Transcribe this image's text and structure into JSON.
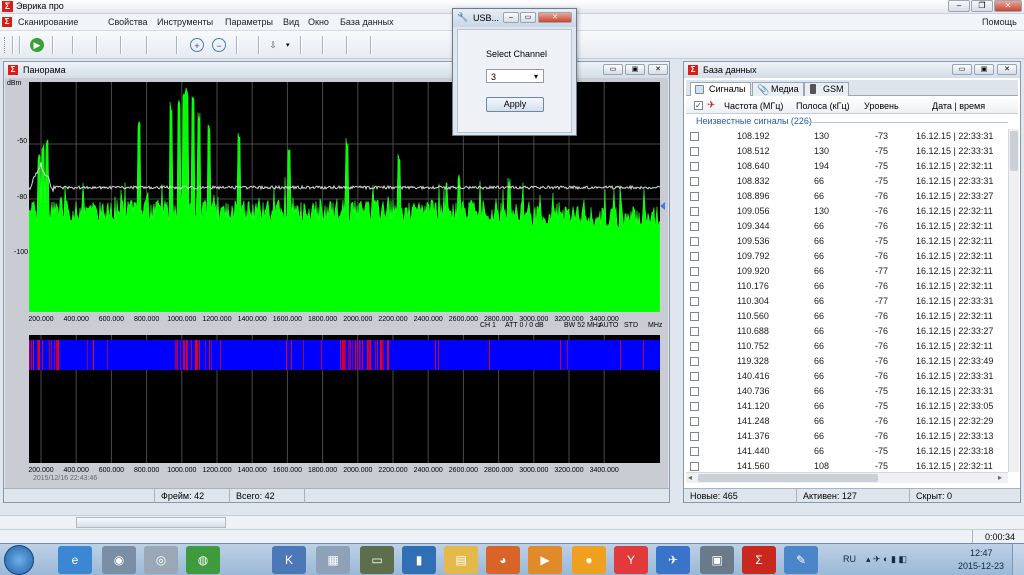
{
  "app": {
    "title": "Эврика про",
    "help": "Помощь"
  },
  "menu": [
    "Сканирование",
    "Свойства",
    "Инструменты",
    "Параметры",
    "Вид",
    "Окно",
    "База данных"
  ],
  "panorama": {
    "title": "Панорама",
    "y_unit": "dBm",
    "y_ticks": [
      "-50",
      "-80",
      "-100"
    ],
    "x_ticks": [
      "200.000",
      "400.000",
      "600.000",
      "800.000",
      "1000.000",
      "1200.000",
      "1400.000",
      "1600.000",
      "1800.000",
      "2000.000",
      "2200.000",
      "2400.000",
      "2600.000",
      "2800.000",
      "3000.000",
      "3200.000",
      "3400.000"
    ],
    "x_unit": "MHz",
    "params": [
      "CH 1",
      "ATT 0 / 0 dB",
      "BW 52 MHz",
      "AUTO",
      "STD"
    ],
    "timestamp": "2015/12/16 22:43:46",
    "frames_label": "Фрейм: 42",
    "total_label": "Всего: 42"
  },
  "dialog": {
    "title": "USB...",
    "label": "Select Channel",
    "value": "3",
    "apply": "Apply"
  },
  "db": {
    "title": "База данных",
    "tabs": [
      "Сигналы",
      "Медиа",
      "GSM"
    ],
    "columns": [
      "Частота (МГц)",
      "Полоса (кГц)",
      "Уровень",
      "Дата | время"
    ],
    "group": "Неизвестные сигналы (226)",
    "rows": [
      [
        "108.192",
        "130",
        "-73",
        "16.12.15 | 22:33:31"
      ],
      [
        "108.512",
        "130",
        "-75",
        "16.12.15 | 22:33:31"
      ],
      [
        "108.640",
        "194",
        "-75",
        "16.12.15 | 22:32:11"
      ],
      [
        "108.832",
        "66",
        "-75",
        "16.12.15 | 22:33:31"
      ],
      [
        "108.896",
        "66",
        "-76",
        "16.12.15 | 22:33:27"
      ],
      [
        "109.056",
        "130",
        "-76",
        "16.12.15 | 22:32:11"
      ],
      [
        "109.344",
        "66",
        "-76",
        "16.12.15 | 22:32:11"
      ],
      [
        "109.536",
        "66",
        "-75",
        "16.12.15 | 22:32:11"
      ],
      [
        "109.792",
        "66",
        "-76",
        "16.12.15 | 22:32:11"
      ],
      [
        "109.920",
        "66",
        "-77",
        "16.12.15 | 22:32:11"
      ],
      [
        "110.176",
        "66",
        "-76",
        "16.12.15 | 22:32:11"
      ],
      [
        "110.304",
        "66",
        "-77",
        "16.12.15 | 22:33:31"
      ],
      [
        "110.560",
        "66",
        "-76",
        "16.12.15 | 22:32:11"
      ],
      [
        "110.688",
        "66",
        "-76",
        "16.12.15 | 22:33:27"
      ],
      [
        "110.752",
        "66",
        "-76",
        "16.12.15 | 22:32:11"
      ],
      [
        "119.328",
        "66",
        "-76",
        "16.12.15 | 22:33:49"
      ],
      [
        "140.416",
        "66",
        "-76",
        "16.12.15 | 22:33:31"
      ],
      [
        "140.736",
        "66",
        "-75",
        "16.12.15 | 22:33:31"
      ],
      [
        "141.120",
        "66",
        "-75",
        "16.12.15 | 22:33:05"
      ],
      [
        "141.248",
        "66",
        "-76",
        "16.12.15 | 22:32:29"
      ],
      [
        "141.376",
        "66",
        "-76",
        "16.12.15 | 22:33:13"
      ],
      [
        "141.440",
        "66",
        "-75",
        "16.12.15 | 22:33:18"
      ],
      [
        "141.560",
        "108",
        "-75",
        "16.12.15 | 22:32:11"
      ]
    ],
    "status": [
      "Новые: 465",
      "Активен: 127",
      "Скрыт: 0"
    ]
  },
  "statusbar": {
    "time": "0:00:34"
  },
  "tray": {
    "lang": "RU",
    "time": "12:47",
    "date": "2015-12-23"
  },
  "colors": {
    "spectrum": "#00ff00",
    "waterfall_bg": "#0000ff",
    "waterfall_hot": "#ff0000"
  }
}
